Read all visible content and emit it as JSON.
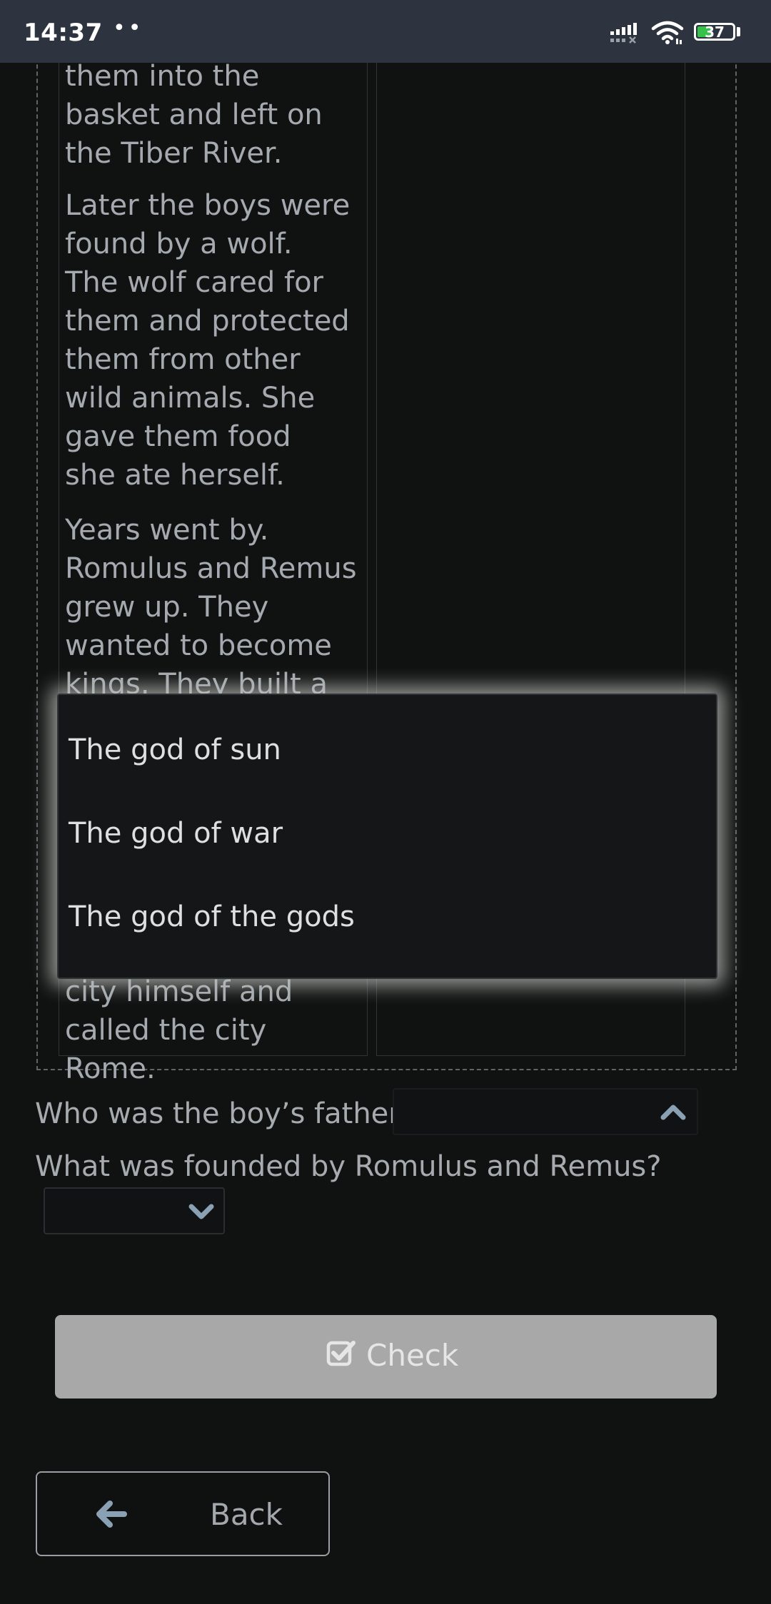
{
  "status_bar": {
    "time": "14:37",
    "dots": "••",
    "battery": "37"
  },
  "story": {
    "paragraph_1": "them into the basket and left on the Tiber River.",
    "paragraph_2": "Later the boys were found by a wolf. The wolf cared for them and protected them from other wild animals. She gave them food she ate herself.",
    "paragraph_3": "Years went by. Romulus and Remus grew up. They wanted to become kings. They built a city, but they",
    "paragraph_4": "city himself and called the city Rome."
  },
  "dropdown_options": [
    "The god of sun",
    "The god of war",
    "The god of the gods"
  ],
  "questions": {
    "q1": "Who was the boy’s father?",
    "q2": "What was founded by Romulus and Remus?"
  },
  "buttons": {
    "check": "Check",
    "back": "Back"
  },
  "colors": {
    "background": "#101111",
    "status_bar": "#2e343f",
    "check_button": "#a8a8a8"
  }
}
